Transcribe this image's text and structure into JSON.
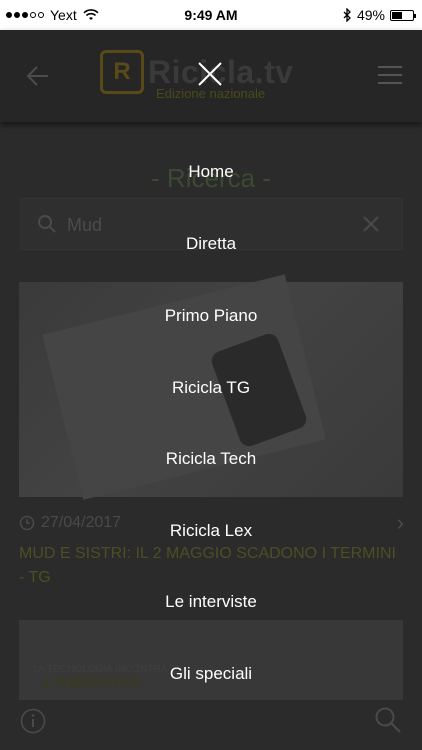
{
  "status_bar": {
    "carrier": "Yext",
    "time": "9:49 AM",
    "battery": "49%",
    "battery_level": 0.49
  },
  "header": {
    "logo_letter": "R",
    "logo_text": "Ricicla.tv",
    "logo_subtitle": "Edizione nazionale"
  },
  "page": {
    "section_title": "- Ricerca -",
    "search_value": "Mud"
  },
  "articles": [
    {
      "date": "27/04/2017",
      "title": "MUD E SISTRI: IL 2 MAGGIO SCADONO I TERMINI - TG"
    },
    {
      "caption_small": "LA TECNOLOGIA INCONTRA",
      "caption_large": "L'AMBIENTE"
    }
  ],
  "menu": {
    "items": [
      "Home",
      "Diretta",
      "Primo Piano",
      "Ricicla TG",
      "Ricicla Tech",
      "Ricicla Lex",
      "Le interviste",
      "Gli speciali"
    ]
  },
  "colors": {
    "overlay_background": "#2b2b2b",
    "menu_text": "#ffffff",
    "logo_accent": "#f0b400"
  },
  "icons": {
    "close": "close-icon",
    "back": "back-arrow-icon",
    "menu": "hamburger-icon",
    "search": "search-icon",
    "info": "info-icon"
  }
}
